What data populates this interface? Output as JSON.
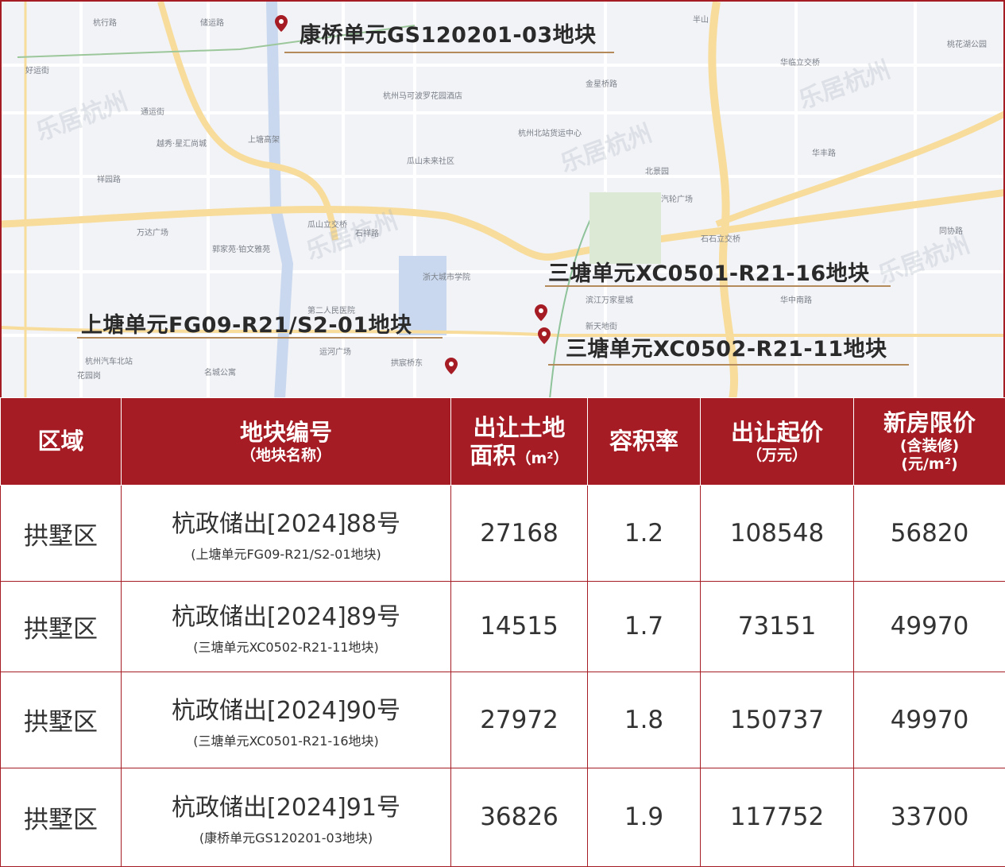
{
  "map": {
    "callouts": [
      {
        "label": "康桥单元GS120201-03地块"
      },
      {
        "label": "三塘单元XC0501-R21-16地块"
      },
      {
        "label": "上塘单元FG09-R21/S2-01地块"
      },
      {
        "label": "三塘单元XC0502-R21-11地块"
      }
    ],
    "places": [
      "杭行路",
      "储运路",
      "好运街",
      "通运街",
      "越秀·星汇尚城",
      "上塘高架",
      "祥园路",
      "杭州马可波罗花园酒店",
      "瓜山未来社区",
      "万达广场",
      "郭家苑·铂文雅苑",
      "瓜山立交桥",
      "石祥路",
      "浙大城市学院",
      "第二人民医院",
      "运河广场",
      "拱宸桥东",
      "杭州汽车北站",
      "名城公寓",
      "花园岗",
      "金星桥路",
      "杭州北站货运中心",
      "华临立交桥",
      "汽轮广场",
      "石石立交桥",
      "滨江万家星城",
      "华中南路",
      "新天地街",
      "同协路",
      "华丰路",
      "北景园",
      "桃花湖公园",
      "半山"
    ],
    "watermark": "乐居杭州"
  },
  "table": {
    "headers": [
      {
        "title": "区域"
      },
      {
        "title": "地块编号",
        "sub": "（地块名称）"
      },
      {
        "title": "出让土地",
        "title2": "面积",
        "sub": "（m²）"
      },
      {
        "title": "容积率"
      },
      {
        "title": "出让起价",
        "sub": "（万元）"
      },
      {
        "title": "新房限价",
        "sub": "(含装修)",
        "sub2": "(元/m²)"
      }
    ],
    "rows": [
      {
        "district": "拱墅区",
        "code": "杭政储出[2024]88号",
        "name": "(上塘单元FG09-R21/S2-01地块)",
        "area": "27168",
        "far": "1.2",
        "price": "108548",
        "limit": "56820"
      },
      {
        "district": "拱墅区",
        "code": "杭政储出[2024]89号",
        "name": "(三塘单元XC0502-R21-11地块)",
        "area": "14515",
        "far": "1.7",
        "price": "73151",
        "limit": "49970"
      },
      {
        "district": "拱墅区",
        "code": "杭政储出[2024]90号",
        "name": "(三塘单元XC0501-R21-16地块)",
        "area": "27972",
        "far": "1.8",
        "price": "150737",
        "limit": "49970"
      },
      {
        "district": "拱墅区",
        "code": "杭政储出[2024]91号",
        "name": "(康桥单元GS120201-03地块)",
        "area": "36826",
        "far": "1.9",
        "price": "117752",
        "limit": "33700"
      }
    ]
  },
  "colors": {
    "brand": "#a61c24",
    "road": "#f7dc9c",
    "water": "#c9d8ee"
  }
}
